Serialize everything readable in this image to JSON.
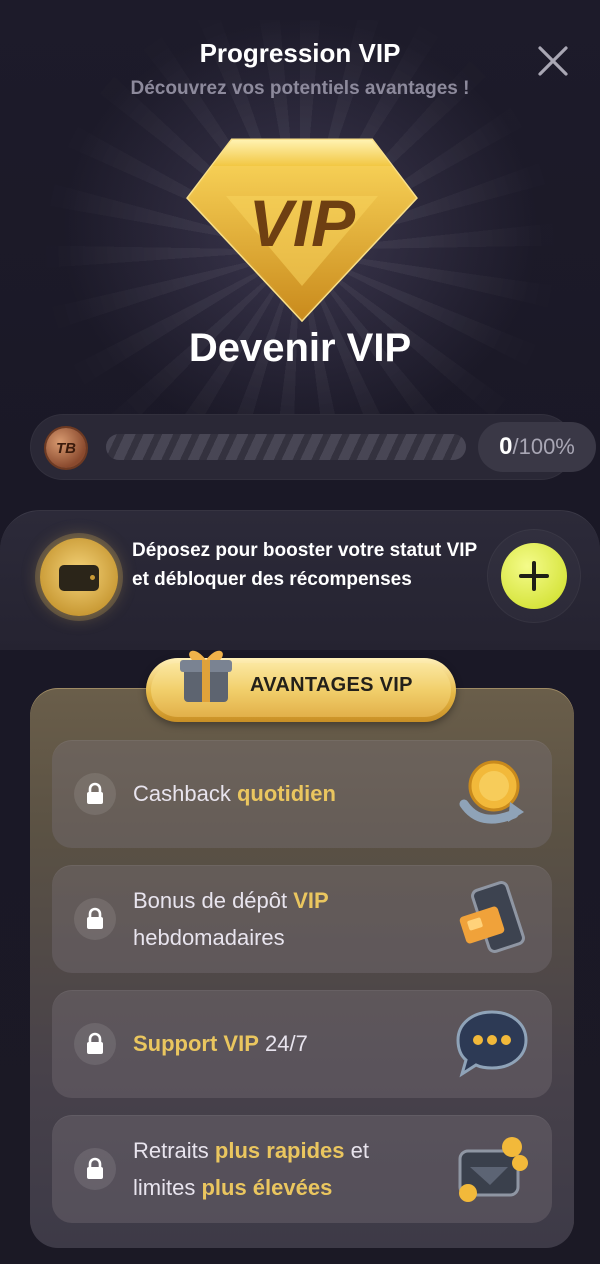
{
  "header": {
    "title": "Progression VIP",
    "subtitle": "Découvrez vos potentiels avantages !"
  },
  "badge": {
    "text": "VIP"
  },
  "heading": "Devenir VIP",
  "progress": {
    "coin_label": "TB",
    "value": 0,
    "value_text": "0",
    "max_text": "/100%"
  },
  "deposit": {
    "text": "Déposez pour booster votre statut VIP et débloquer des récompenses"
  },
  "benefits": {
    "label": "AVANTAGES VIP",
    "items": [
      {
        "parts": [
          {
            "t": "Cashback ",
            "hl": false
          },
          {
            "t": "quotidien",
            "hl": true
          }
        ],
        "icon": "coin-cashback-icon"
      },
      {
        "parts": [
          {
            "t": "Bonus de dépôt ",
            "hl": false
          },
          {
            "t": "VIP",
            "hl": true
          },
          {
            "t": " hebdomadaires",
            "hl": false
          }
        ],
        "icon": "phone-deposit-icon"
      },
      {
        "parts": [
          {
            "t": "Support VIP",
            "hl": true
          },
          {
            "t": " 24/7",
            "hl": false
          }
        ],
        "icon": "chat-bubble-icon"
      },
      {
        "parts": [
          {
            "t": "Retraits ",
            "hl": false
          },
          {
            "t": "plus rapides",
            "hl": true
          },
          {
            "t": " et limites ",
            "hl": false
          },
          {
            "t": "plus élevées",
            "hl": true
          }
        ],
        "icon": "wallet-coins-icon"
      }
    ]
  },
  "colors": {
    "accent_gold": "#eac65f",
    "plus_button": "#d6e43c",
    "background": "#1b1925"
  }
}
